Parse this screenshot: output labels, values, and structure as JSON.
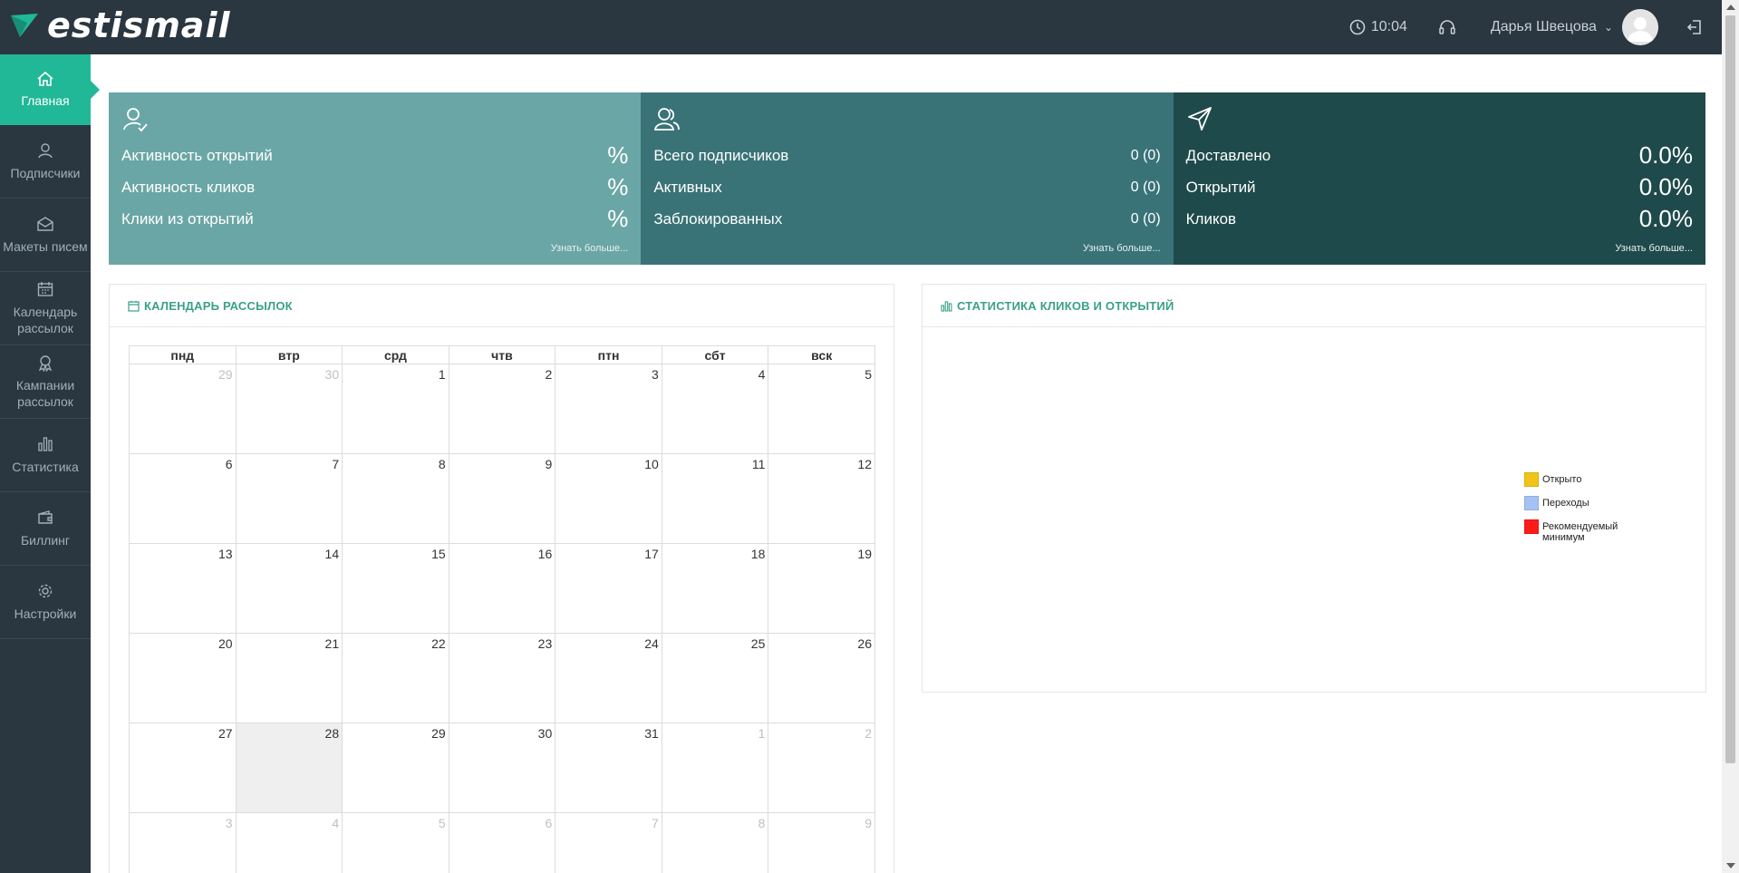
{
  "header": {
    "brand": "estismail",
    "time": "10:04",
    "user_name": "Дарья Швецова"
  },
  "sidebar": {
    "items": [
      {
        "label": "Главная",
        "icon": "home-icon"
      },
      {
        "label": "Подписчики",
        "icon": "subscribers-icon"
      },
      {
        "label": "Макеты писем",
        "icon": "envelope-icon"
      },
      {
        "label": "Календарь рассылок",
        "icon": "calendar-icon"
      },
      {
        "label": "Кампании рассылок",
        "icon": "award-icon"
      },
      {
        "label": "Статистика",
        "icon": "bar-chart-icon"
      },
      {
        "label": "Биллинг",
        "icon": "wallet-icon"
      },
      {
        "label": "Настройки",
        "icon": "gear-icon"
      }
    ]
  },
  "tiles": [
    {
      "icon": "user-check-icon",
      "rows": [
        {
          "label": "Активность открытий",
          "value": "%"
        },
        {
          "label": "Активность кликов",
          "value": "%"
        },
        {
          "label": "Клики из открытий",
          "value": "%"
        }
      ],
      "more": "Узнать больше..."
    },
    {
      "icon": "users-icon",
      "rows": [
        {
          "label": "Всего подписчиков",
          "value": "0 (0)"
        },
        {
          "label": "Активных",
          "value": "0 (0)"
        },
        {
          "label": "Заблокированных",
          "value": "0 (0)"
        }
      ],
      "more": "Узнать больше..."
    },
    {
      "icon": "send-icon",
      "rows": [
        {
          "label": "Доставлено",
          "value": "0.0%"
        },
        {
          "label": "Открытий",
          "value": "0.0%"
        },
        {
          "label": "Кликов",
          "value": "0.0%"
        }
      ],
      "more": "Узнать больше..."
    }
  ],
  "calendar": {
    "title": "КАЛЕНДАРЬ РАССЫЛОК",
    "weekdays": [
      "пнд",
      "втр",
      "срд",
      "чтв",
      "птн",
      "сбт",
      "вск"
    ],
    "weeks": [
      [
        "29",
        "30",
        "1",
        "2",
        "3",
        "4",
        "5"
      ],
      [
        "6",
        "7",
        "8",
        "9",
        "10",
        "11",
        "12"
      ],
      [
        "13",
        "14",
        "15",
        "16",
        "17",
        "18",
        "19"
      ],
      [
        "20",
        "21",
        "22",
        "23",
        "24",
        "25",
        "26"
      ],
      [
        "27",
        "28",
        "29",
        "30",
        "31",
        "1",
        "2"
      ],
      [
        "3",
        "4",
        "5",
        "6",
        "7",
        "8",
        "9"
      ]
    ]
  },
  "stats": {
    "title": "СТАТИСТИКА КЛИКОВ И ОТКРЫТИЙ",
    "legend": [
      {
        "label": "Открыто",
        "color": "#f0c419"
      },
      {
        "label": "Переходы",
        "color": "#a4c2f4"
      },
      {
        "label": "Рекомендуемый минимум",
        "color": "#ff1a1a"
      }
    ]
  },
  "colors": {
    "accent": "#21b897",
    "dark": "#2a3640",
    "tile1": "#6ba6a6",
    "tile2": "#397378",
    "tile3": "#1f4a4b"
  }
}
